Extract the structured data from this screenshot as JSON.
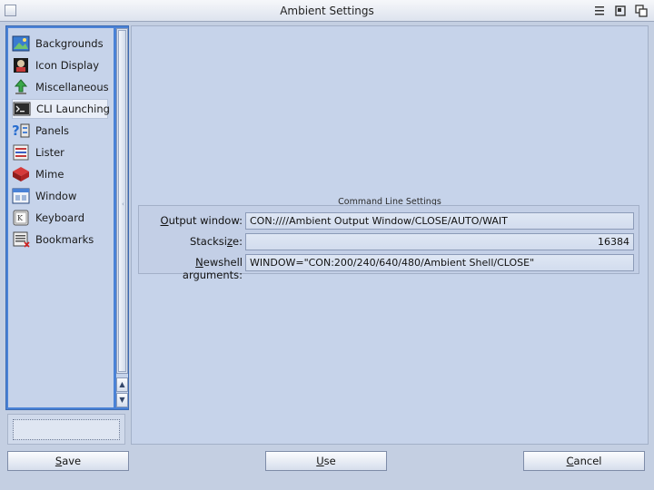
{
  "window": {
    "title": "Ambient Settings"
  },
  "sidebar": {
    "items": [
      {
        "label": "Backgrounds",
        "icon": "backgrounds-icon"
      },
      {
        "label": "Icon Display",
        "icon": "icon-display-icon"
      },
      {
        "label": "Miscellaneous",
        "icon": "miscellaneous-icon"
      },
      {
        "label": "CLI Launching",
        "icon": "cli-launching-icon",
        "selected": true
      },
      {
        "label": "Panels",
        "icon": "panels-icon"
      },
      {
        "label": "Lister",
        "icon": "lister-icon"
      },
      {
        "label": "Mime",
        "icon": "mime-icon"
      },
      {
        "label": "Window",
        "icon": "window-icon"
      },
      {
        "label": "Keyboard",
        "icon": "keyboard-icon"
      },
      {
        "label": "Bookmarks",
        "icon": "bookmarks-icon"
      }
    ]
  },
  "group": {
    "title": "Command Line Settings",
    "output_window": {
      "label_key": "O",
      "label_rest": "utput window:",
      "value": "CON:////Ambient Output Window/CLOSE/AUTO/WAIT"
    },
    "stacksize": {
      "label_pre": "Stacksi",
      "label_key": "z",
      "label_post": "e:",
      "value": "16384"
    },
    "newshell": {
      "label_key": "N",
      "label_rest": "ewshell arguments:",
      "value": "WINDOW=\"CON:200/240/640/480/Ambient Shell/CLOSE\""
    }
  },
  "buttons": {
    "save": {
      "key": "S",
      "rest": "ave"
    },
    "use": {
      "key": "U",
      "rest": "se"
    },
    "cancel": {
      "key": "C",
      "rest": "ancel"
    }
  },
  "colors": {
    "sidebar_frame": "#4a82d6",
    "panel_bg": "#c6d3ea"
  }
}
